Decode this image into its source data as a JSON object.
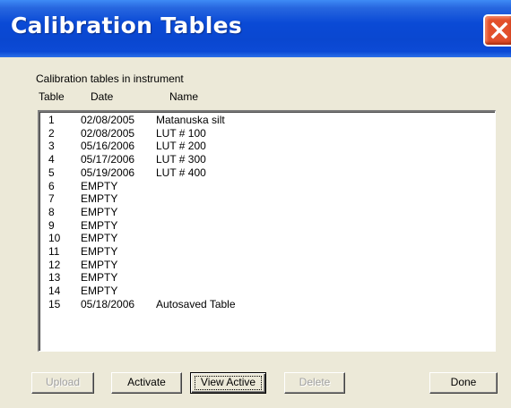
{
  "window": {
    "title": "Calibration Tables",
    "caption": "Calibration tables in instrument"
  },
  "columns": {
    "table": "Table",
    "date": "Date",
    "name": "Name"
  },
  "rows": [
    {
      "table": "1",
      "date": "02/08/2005",
      "name": "Matanuska silt"
    },
    {
      "table": "2",
      "date": "02/08/2005",
      "name": "LUT # 100"
    },
    {
      "table": "3",
      "date": "05/16/2006",
      "name": "LUT # 200"
    },
    {
      "table": "4",
      "date": "05/17/2006",
      "name": "LUT # 300"
    },
    {
      "table": "5",
      "date": "05/19/2006",
      "name": "LUT # 400"
    },
    {
      "table": "6",
      "date": "EMPTY",
      "name": ""
    },
    {
      "table": "7",
      "date": "EMPTY",
      "name": ""
    },
    {
      "table": "8",
      "date": "EMPTY",
      "name": ""
    },
    {
      "table": "9",
      "date": "EMPTY",
      "name": ""
    },
    {
      "table": "10",
      "date": "EMPTY",
      "name": ""
    },
    {
      "table": "11",
      "date": "EMPTY",
      "name": ""
    },
    {
      "table": "12",
      "date": "EMPTY",
      "name": ""
    },
    {
      "table": "13",
      "date": "EMPTY",
      "name": ""
    },
    {
      "table": "14",
      "date": "EMPTY",
      "name": ""
    },
    {
      "table": "15",
      "date": "05/18/2006",
      "name": "Autosaved Table"
    }
  ],
  "buttons": {
    "upload": "Upload",
    "activate": "Activate",
    "view_active": "View Active",
    "delete": "Delete",
    "done": "Done"
  },
  "icons": {
    "close": "close-icon"
  },
  "colors": {
    "titlebar": "#0a4ad6",
    "close_button": "#e2502b",
    "dialog_bg": "#ece9d8"
  }
}
